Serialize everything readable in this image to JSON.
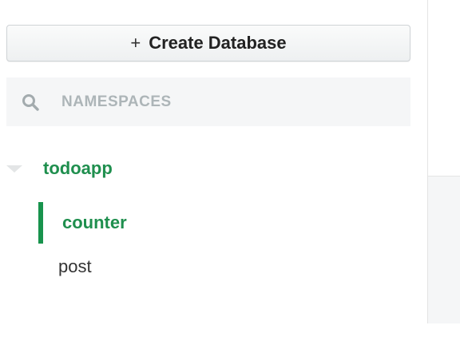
{
  "sidebar": {
    "create_button": {
      "plus": "+",
      "label": "Create Database"
    },
    "search": {
      "icon": "search-icon",
      "placeholder": "NAMESPACES"
    },
    "databases": [
      {
        "name": "todoapp",
        "expanded": true,
        "collections": [
          {
            "name": "counter",
            "active": true
          },
          {
            "name": "post",
            "active": false
          }
        ]
      }
    ]
  },
  "colors": {
    "accent_green": "#1f8f4e",
    "active_bar": "#18934d",
    "search_bg": "#f5f6f7",
    "muted_text": "#adb5b8"
  }
}
